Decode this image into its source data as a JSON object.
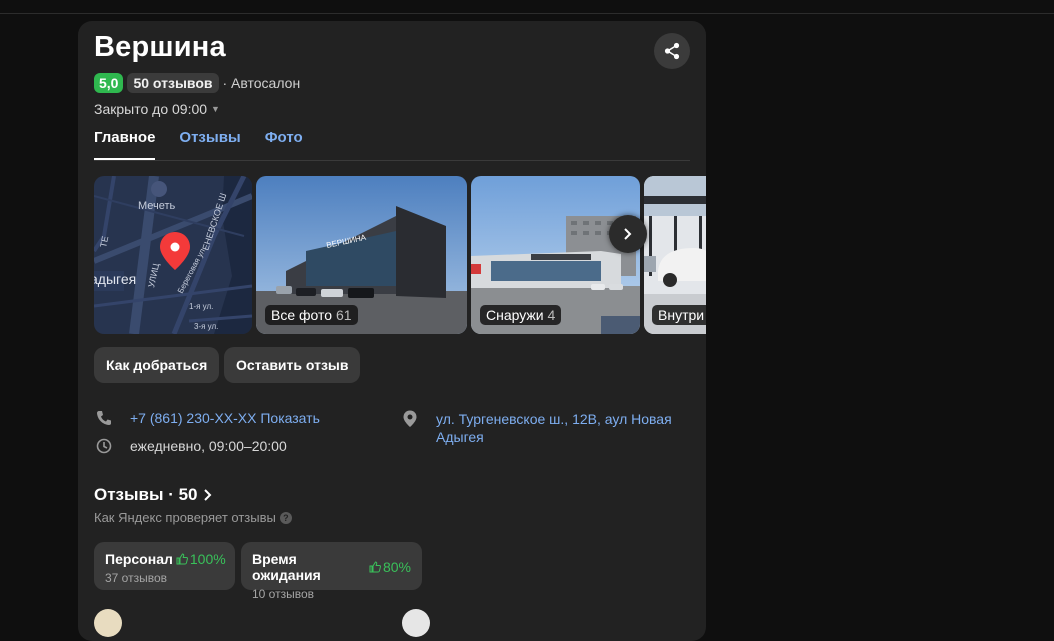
{
  "place": {
    "name": "Вершина",
    "rating": "5,0",
    "reviews_badge": "50 отзывов",
    "category": "· Автосалон",
    "status": "Закрыто до 09:00"
  },
  "tabs": [
    {
      "label": "Главное",
      "active": true
    },
    {
      "label": "Отзывы",
      "active": false
    },
    {
      "label": "Фото",
      "active": false
    }
  ],
  "map": {
    "labels": [
      "Мечеть",
      "ЕНЕВСКОЕ Ш",
      "Береговая ул.",
      "УЛИЦ",
      "ТЕ",
      "адыгея",
      "1-я ул.",
      "3-я ул."
    ]
  },
  "gallery": [
    {
      "label": "Все фото",
      "count": "61"
    },
    {
      "label": "Снаружи",
      "count": "4"
    },
    {
      "label": "Внутри",
      "count": ""
    }
  ],
  "actions": {
    "route": "Как добраться",
    "review": "Оставить отзыв"
  },
  "contacts": {
    "phone": "+7 (861) 230-XX-XX Показать",
    "hours": "ежедневно, 09:00–20:00",
    "address_line1": "ул. Тургеневское ш., 12В, аул Новая",
    "address_line2": "Адыгея"
  },
  "reviews": {
    "heading": "Отзывы · 50",
    "check_link": "Как Яндекс проверяет отзывы",
    "aspects": [
      {
        "name": "Персонал",
        "percent": "100%",
        "count": "37 отзывов"
      },
      {
        "name": "Время ожидания",
        "percent": "80%",
        "count": "10 отзывов"
      }
    ]
  },
  "colors": {
    "background": "#0f0f0f",
    "card": "#222222",
    "rating_green": "#2fb84f",
    "link_blue": "#7eaef0",
    "map_pin": "#f33a3a"
  }
}
